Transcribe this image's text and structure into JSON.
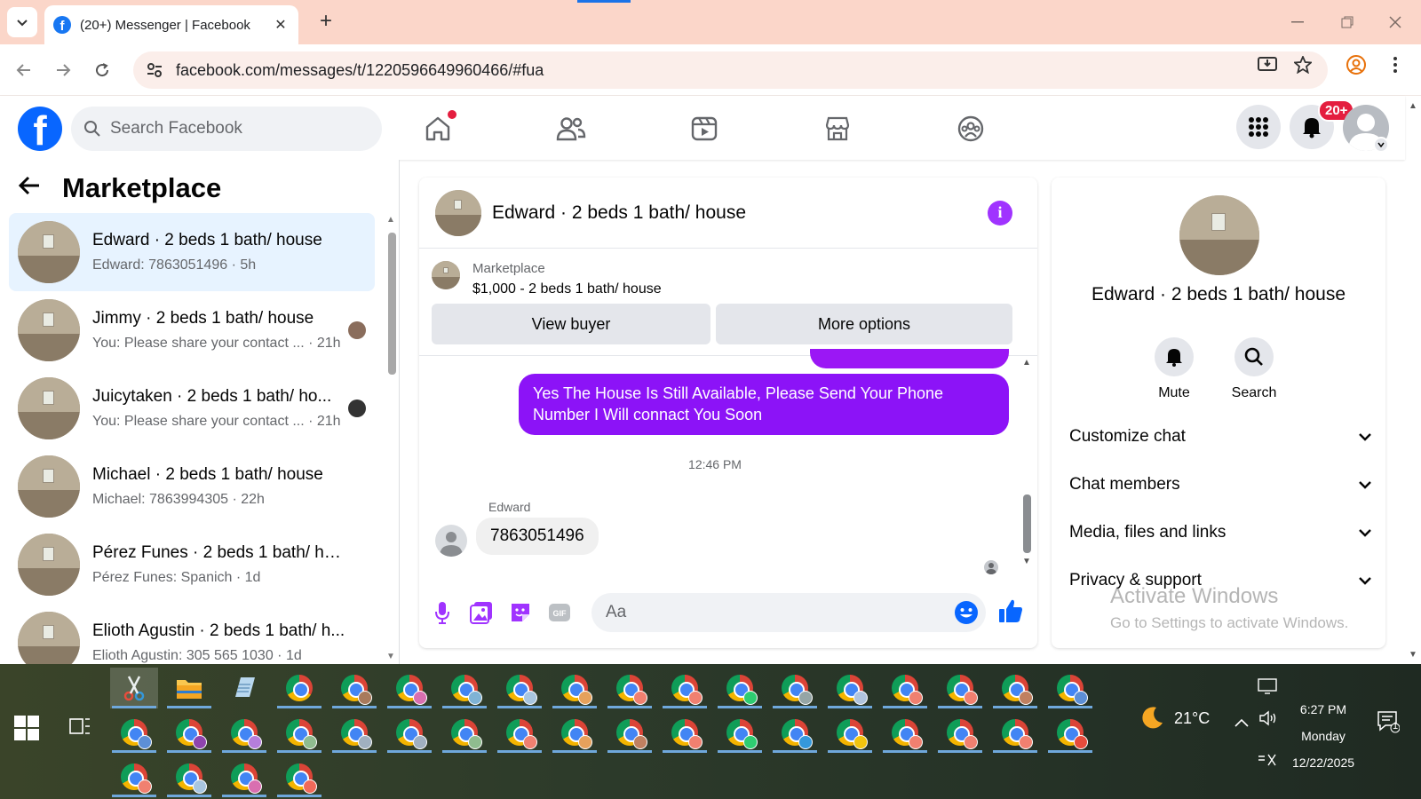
{
  "browser": {
    "tab_title": "(20+) Messenger | Facebook",
    "url": "facebook.com/messages/t/1220596649960466/#fua",
    "new_tab": "+",
    "tab_close": "✕"
  },
  "fb_header": {
    "logo": "f",
    "search_placeholder": "Search Facebook",
    "notifications_badge": "20+",
    "nav_icons": [
      "home-icon",
      "friends-icon",
      "video-icon",
      "marketplace-icon",
      "groups-icon"
    ]
  },
  "sidebar": {
    "title": "Marketplace",
    "conversations": [
      {
        "name": "Edward · 2 beds 1 bath/ house",
        "preview": "Edward: 7863051496 · 5h",
        "active": true
      },
      {
        "name": "Jimmy · 2 beds 1 bath/ house",
        "preview": "You: Please share your contact ... · 21h",
        "active": false
      },
      {
        "name": "Juicytaken · 2 beds 1 bath/ ho...",
        "preview": "You: Please share your contact ... · 21h",
        "active": false
      },
      {
        "name": "Michael · 2 beds 1 bath/ house",
        "preview": "Michael: 7863994305 · 22h",
        "active": false
      },
      {
        "name": "Pérez Funes · 2 beds 1 bath/ hou...",
        "preview": "Pérez Funes: Spanich · 1d",
        "active": false
      },
      {
        "name": "Elioth Agustin · 2 beds 1 bath/ h...",
        "preview": "Elioth Agustin: 305 565 1030 · 1d",
        "active": false
      }
    ]
  },
  "chat": {
    "title": "Edward · 2 beds 1 bath/ house",
    "listing_source": "Marketplace",
    "listing_price": "$1,000 - 2 beds 1 bath/ house",
    "view_buyer_label": "View buyer",
    "more_options_label": "More options",
    "outgoing_message": "Yes The House Is Still Available, Please Send Your Phone Number I Will connact You Soon",
    "timestamp": "12:46 PM",
    "sender_name": "Edward",
    "incoming_message": "7863051496",
    "composer_placeholder": "Aa",
    "gif_label": "GIF"
  },
  "info_panel": {
    "name": "Edward · 2 beds 1 bath/ house",
    "mute_label": "Mute",
    "search_label": "Search",
    "sections": [
      "Customize chat",
      "Chat members",
      "Media, files and links",
      "Privacy & support"
    ]
  },
  "watermark": {
    "line1": "Activate Windows",
    "line2": "Go to Settings to activate Windows."
  },
  "taskbar": {
    "temperature": "21°C",
    "time": "6:27 PM",
    "day": "Monday",
    "date": "12/22/2025",
    "notification_count": "1"
  },
  "colors": {
    "fb_blue": "#0866ff",
    "messenger_purple": "#8c13f7",
    "notif_red": "#e41e3f",
    "active_conv_bg": "#e7f3ff",
    "chrome_tab_strip": "#fbd6c9"
  }
}
